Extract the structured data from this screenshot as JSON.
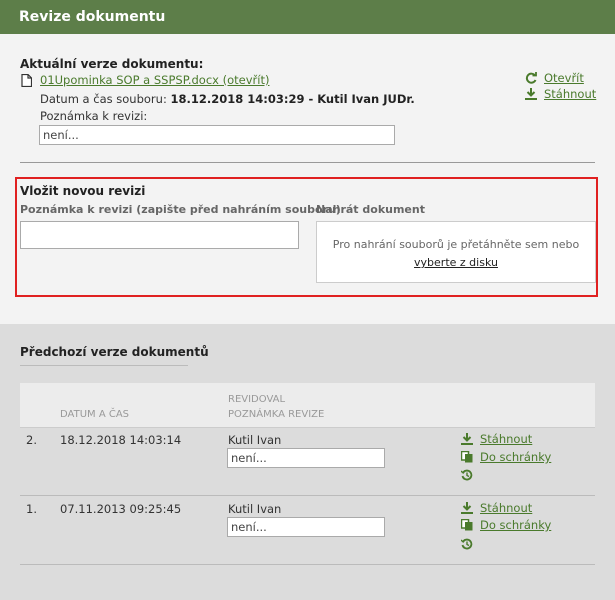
{
  "header": {
    "title": "Revize dokumentu"
  },
  "current": {
    "title": "Aktuální verze dokumentu:",
    "file_link": "01Upominka SOP a SSPSP.docx (otevřít)",
    "meta_prefix": "Datum a čas souboru: ",
    "meta_value": "18.12.2018 14:03:29 - Kutil Ivan JUDr.",
    "note_label": "Poznámka k revizi:",
    "note_value": "není...",
    "open_label": "Otevřít",
    "download_label": "Stáhnout"
  },
  "new_revision": {
    "title": "Vložit novou revizi",
    "note_label": "Poznámka k revizi (zapište před nahráním souboru)",
    "upload_label": "Nahrát dokument",
    "drop_text": "Pro nahrání souborů je přetáhněte sem nebo",
    "drop_link": "vyberte z disku"
  },
  "previous": {
    "title": "Předchozí verze dokumentů",
    "columns": {
      "date": "DATUM A ČAS",
      "reviewer": "REVIDOVAL",
      "note": "POZNÁMKA REVIZE"
    },
    "rows": [
      {
        "num": "2.",
        "date": "18.12.2018 14:03:14",
        "reviewer": "Kutil Ivan",
        "note": "není...",
        "download": "Stáhnout",
        "clipboard": "Do schránky"
      },
      {
        "num": "1.",
        "date": "07.11.2013 09:25:45",
        "reviewer": "Kutil Ivan",
        "note": "není...",
        "download": "Stáhnout",
        "clipboard": "Do schránky"
      }
    ]
  },
  "colors": {
    "header_bg": "#5d7e49",
    "link": "#4a7a2c",
    "highlight": "#e02020"
  }
}
